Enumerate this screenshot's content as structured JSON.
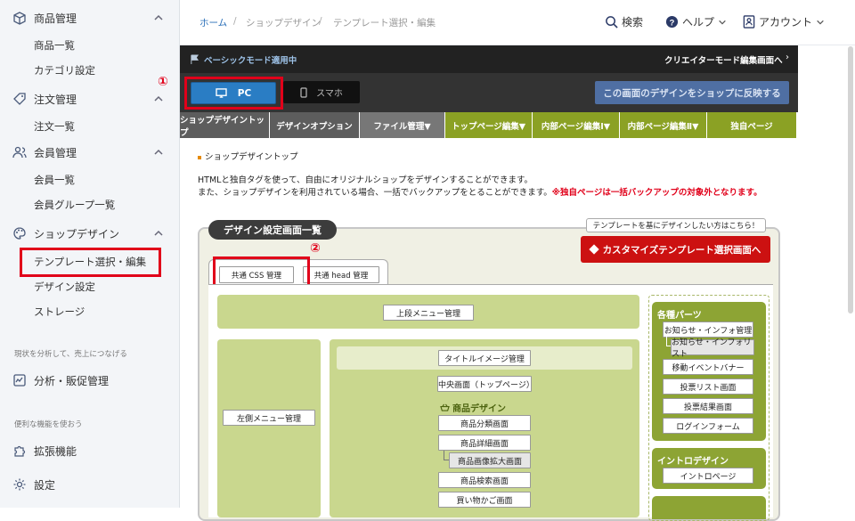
{
  "sidebar": {
    "groups": [
      {
        "label": "商品管理",
        "icon": "box-icon",
        "items": [
          "商品一覧",
          "カテゴリ設定"
        ]
      },
      {
        "label": "注文管理",
        "icon": "tag-icon",
        "items": [
          "注文一覧"
        ]
      },
      {
        "label": "会員管理",
        "icon": "users-icon",
        "items": [
          "会員一覧",
          "会員グループ一覧"
        ]
      },
      {
        "label": "ショップデザイン",
        "icon": "palette-icon",
        "items": [
          "テンプレート選択・編集",
          "デザイン設定",
          "ストレージ"
        ]
      }
    ],
    "caption1": "現状を分析して、売上につなげる",
    "analytics": "分析・販促管理",
    "caption2": "便利な機能を使おう",
    "extensions": "拡張機能",
    "settings": "設定"
  },
  "header": {
    "breadcrumb": [
      "ホーム",
      "ショップデザイン",
      "テンプレート選択・編集"
    ],
    "search": "検索",
    "help": "ヘルプ",
    "account": "アカウント"
  },
  "editor": {
    "mode_label": "ベーシックモード適用中",
    "creator_link": "クリエイターモード編集画面へ",
    "pc": "PC",
    "sp": "スマホ",
    "apply_button": "この画面のデザインをショップに反映する",
    "tabs": [
      "ショップデザイントップ",
      "デザインオプション",
      "ファイル管理▼",
      "トップページ編集▼",
      "内部ページ編集Ⅰ▼",
      "内部ページ編集Ⅱ▼",
      "独自ページ"
    ],
    "page_heading": "ショップデザイントップ",
    "desc1": "HTMLと独自タグを使って、自由にオリジナルショップをデザインすることができます。",
    "desc2": "また、ショップデザインを利用されている場合、一括でバックアップをとることができます。",
    "desc2_note": "※独自ページは一括バックアップの対象外となります。",
    "panel_title": "デザイン設定画面一覧",
    "template_hint": "テンプレートを基にデザインしたい方はこちら！",
    "customize_button": "カスタマイズテンプレート選択画面へ",
    "subtabs": [
      "共通 CSS 管理",
      "共通 head 管理"
    ],
    "upper_menu": "上段メニュー管理",
    "left_menu": "左側メニュー管理",
    "title_image": "タイトルイメージ管理",
    "center_screen": "中央画面（トップページ）",
    "product_design": "商品デザイン",
    "product_buttons": [
      "商品分類画面",
      "商品詳細画面",
      "商品画像拡大画面",
      "商品検索画面",
      "買い物かご画面"
    ],
    "parts_title": "各種パーツ",
    "parts_buttons": [
      "お知らせ・インフォ管理",
      "お知らせ・インフォリスト",
      "移動イベントバナー",
      "投票リスト画面",
      "投票結果画面",
      "ログインフォーム"
    ],
    "intro_title": "イントロデザイン",
    "intro_button": "イントロページ",
    "callout1": "①",
    "callout2": "②"
  },
  "colors": {
    "accent_red": "#e1001a",
    "olive": "#8ba124",
    "link_blue": "#2a6fb8"
  }
}
